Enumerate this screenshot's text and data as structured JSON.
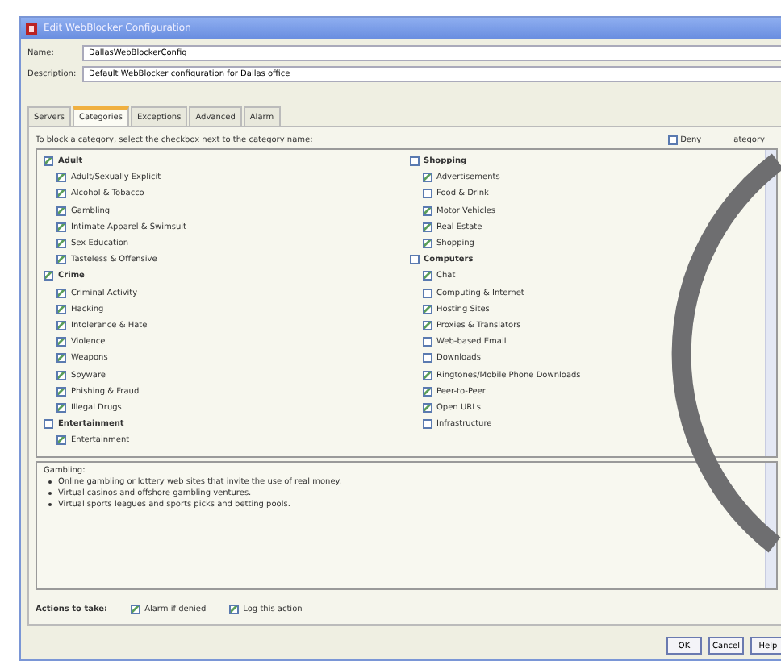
{
  "window": {
    "title": "Edit WebBlocker Configuration"
  },
  "fields": [
    {
      "label": "Name:",
      "value": "DallasWebBlockerConfig"
    },
    {
      "label": "Description:",
      "value": "Default WebBlocker configuration for Dallas office"
    }
  ],
  "tabs": [
    {
      "label": "Servers",
      "selected": false
    },
    {
      "label": "Categories",
      "selected": true
    },
    {
      "label": "Exceptions",
      "selected": false
    },
    {
      "label": "Advanced",
      "selected": false
    },
    {
      "label": "Alarm",
      "selected": false
    }
  ],
  "instruction": "To block a category, select the checkbox next to the category name:",
  "deny_all": {
    "label_start": "Deny",
    "label_end": "ategory",
    "checked": false
  },
  "columns": [
    [
      {
        "name": "Adult",
        "checked": true,
        "children": [
          {
            "name": "Adult/Sexually Explicit",
            "checked": true
          },
          {
            "name": "Alcohol & Tobacco",
            "checked": true
          },
          {
            "name": "Gambling",
            "checked": true
          },
          {
            "name": "Intimate Apparel & Swimsuit",
            "checked": true
          },
          {
            "name": "Sex Education",
            "checked": true
          },
          {
            "name": "Tasteless & Offensive",
            "checked": true
          }
        ]
      },
      {
        "name": "Crime",
        "checked": true,
        "children": [
          {
            "name": "Criminal Activity",
            "checked": true
          },
          {
            "name": "Hacking",
            "checked": true
          },
          {
            "name": "Intolerance & Hate",
            "checked": true
          },
          {
            "name": "Violence",
            "checked": true
          },
          {
            "name": "Weapons",
            "checked": true
          },
          {
            "name": "Spyware",
            "checked": true
          },
          {
            "name": "Phishing & Fraud",
            "checked": true
          },
          {
            "name": "Illegal Drugs",
            "checked": true
          }
        ]
      },
      {
        "name": "Entertainment",
        "checked": false,
        "children": [
          {
            "name": "Entertainment",
            "checked": true
          }
        ]
      }
    ],
    [
      {
        "name": "Shopping",
        "checked": false,
        "children": [
          {
            "name": "Advertisements",
            "checked": true
          },
          {
            "name": "Food & Drink",
            "checked": false
          },
          {
            "name": "Motor Vehicles",
            "checked": true
          },
          {
            "name": "Real Estate",
            "checked": true
          },
          {
            "name": "Shopping",
            "checked": true
          }
        ]
      },
      {
        "name": "Computers",
        "checked": false,
        "children": [
          {
            "name": "Chat",
            "checked": true
          },
          {
            "name": "Computing & Internet",
            "checked": false
          },
          {
            "name": "Hosting Sites",
            "checked": true
          },
          {
            "name": "Proxies & Translators",
            "checked": true
          },
          {
            "name": "Web-based Email",
            "checked": false
          },
          {
            "name": "Downloads",
            "checked": false
          },
          {
            "name": "Ringtones/Mobile Phone Downloads",
            "checked": true
          },
          {
            "name": "Peer-to-Peer",
            "checked": true
          },
          {
            "name": "Open URLs",
            "checked": true
          },
          {
            "name": "Infrastructure",
            "checked": false
          }
        ]
      }
    ]
  ],
  "description": {
    "title": "Gambling:",
    "bullets": [
      "Online gambling or lottery web sites that invite the use of real money.",
      "Virtual casinos and offshore gambling ventures.",
      "Virtual sports leagues and sports picks and betting pools."
    ]
  },
  "actions": {
    "label": "Actions to take:",
    "options": [
      {
        "label": "Alarm if denied",
        "checked": true
      },
      {
        "label": "Log this action",
        "checked": true
      }
    ]
  },
  "buttons": [
    "OK",
    "Cancel",
    "Help"
  ]
}
